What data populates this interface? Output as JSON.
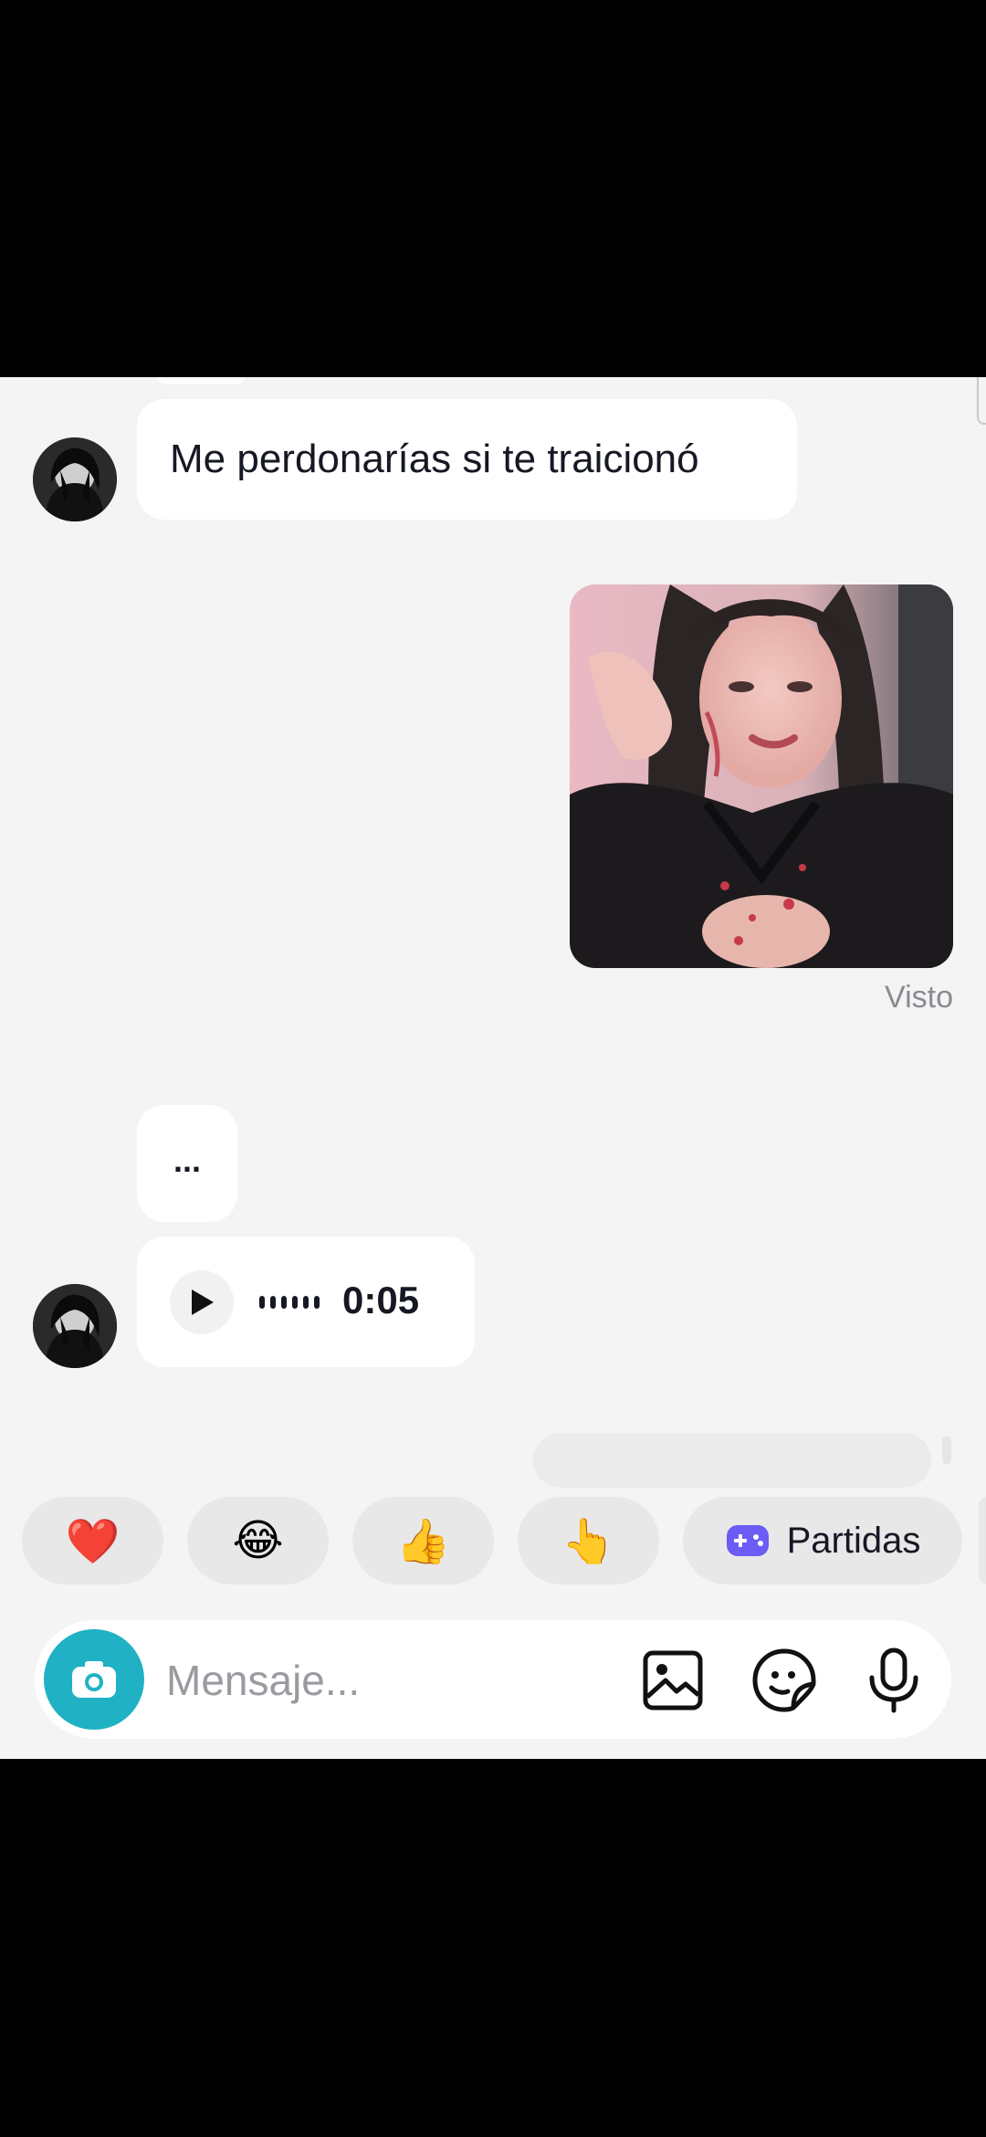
{
  "conversation": {
    "messages": [
      {
        "type": "text",
        "direction": "received",
        "text": "Me perdonarías si te traicionó"
      },
      {
        "type": "image",
        "direction": "sent",
        "status": "Visto"
      },
      {
        "type": "text",
        "direction": "received",
        "text": "..."
      },
      {
        "type": "voice",
        "direction": "received",
        "duration": "0:05"
      }
    ]
  },
  "quick_reactions": [
    {
      "emoji": "❤️",
      "icon": "red-heart-icon"
    },
    {
      "emoji": "😂",
      "icon": "tears-of-joy-icon"
    },
    {
      "emoji": "👍",
      "icon": "thumbs-up-icon"
    },
    {
      "emoji": "👆",
      "icon": "pointing-up-icon"
    }
  ],
  "games_chip": {
    "label": "Partidas",
    "icon": "gamepad-icon",
    "icon_color": "#6b5cf6"
  },
  "composer": {
    "placeholder": "Mensaje...",
    "camera_color": "#20b1c4",
    "icons": [
      "camera-icon",
      "gallery-icon",
      "sticker-icon",
      "microphone-icon"
    ]
  }
}
